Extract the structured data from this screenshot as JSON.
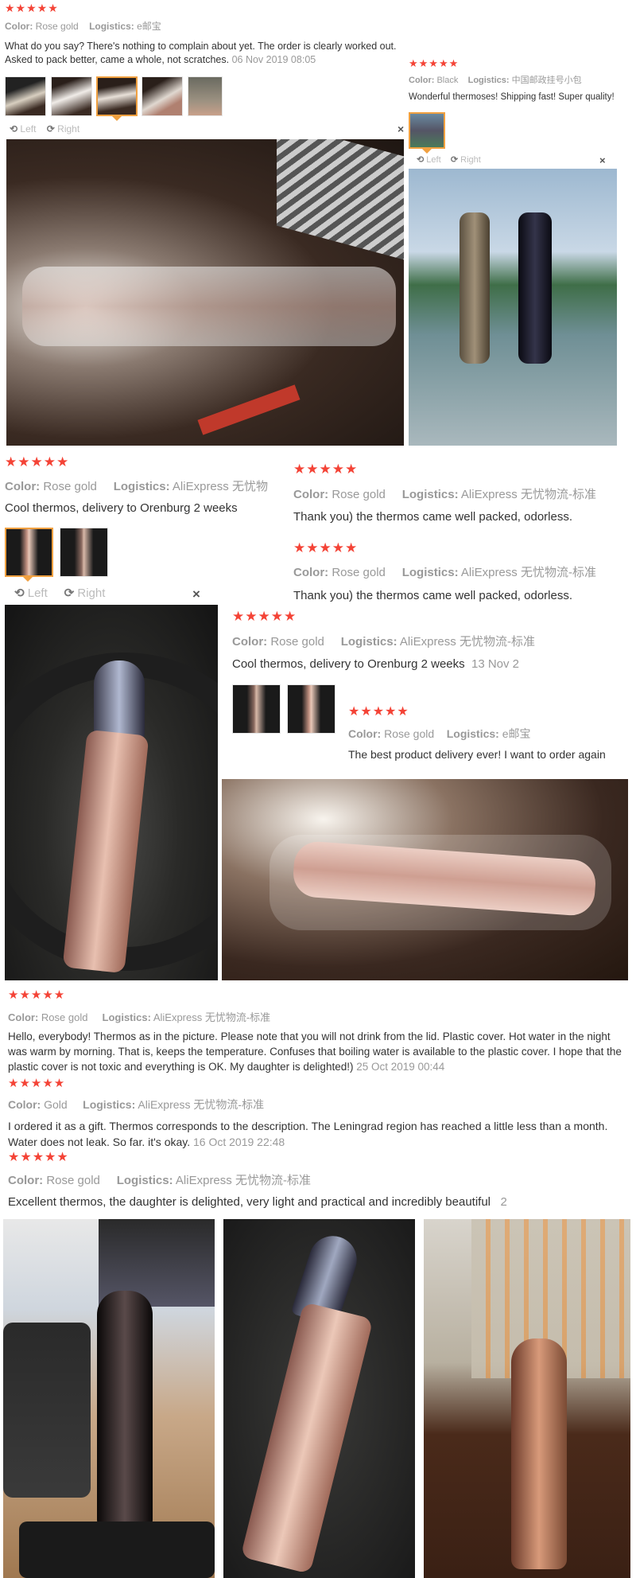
{
  "colors": {
    "star": "#f44336",
    "accent": "#f0a040",
    "muted": "#999999"
  },
  "labels": {
    "color": "Color:",
    "logistics": "Logistics:",
    "left": "Left",
    "right": "Right",
    "close": "×"
  },
  "stars": "★★★★★",
  "reviews": [
    {
      "color": "Rose gold",
      "logistics": "e邮宝",
      "text": "What do you say? There's nothing to complain about yet. The order is clearly worked out. Asked to pack better, came a whole, not scratches.",
      "date": "06 Nov 2019 08:05"
    },
    {
      "color": "Black",
      "logistics": "中国邮政挂号小包",
      "text": "Wonderful thermoses! Shipping fast! Super quality!"
    },
    {
      "color": "Rose gold",
      "logistics": "AliExpress 无忧物",
      "text": "Cool thermos, delivery to Orenburg 2 weeks"
    },
    {
      "color": "Rose gold",
      "logistics": "AliExpress 无忧物流-标准",
      "text": "Thank you) the thermos came well packed, odorless."
    },
    {
      "color": "Rose gold",
      "logistics": "AliExpress 无忧物流-标准",
      "text": "Thank you) the thermos came well packed, odorless."
    },
    {
      "color": "Rose gold",
      "logistics": "AliExpress 无忧物流-标准",
      "text": "Cool thermos, delivery to Orenburg 2 weeks",
      "date": "13 Nov 2"
    },
    {
      "color": "Rose gold",
      "logistics": "e邮宝",
      "text": "The best product delivery ever! I want to order again"
    },
    {
      "color": "Rose gold",
      "logistics": "AliExpress 无忧物流-标准",
      "text": "Hello, everybody! Thermos as in the picture. Please note that you will not drink from the lid. Plastic cover. Hot water in the night was warm by morning. That is, keeps the temperature. Confuses that boiling water is available to the plastic cover. I hope that the plastic cover is not toxic and everything is OK. My daughter is delighted!)",
      "date": "25 Oct 2019 00:44"
    },
    {
      "color": "Gold",
      "logistics": "AliExpress 无忧物流-标准",
      "text": "I ordered it as a gift. Thermos corresponds to the description. The Leningrad region has reached a little less than a month. Water does not leak. So far. it's okay.",
      "date": "16 Oct 2019 22:48"
    },
    {
      "color": "Rose gold",
      "logistics": "AliExpress 无忧物流-标准",
      "text": "Excellent thermos, the daughter is delighted, very light and practical and incredibly beautiful",
      "date": "2"
    }
  ]
}
